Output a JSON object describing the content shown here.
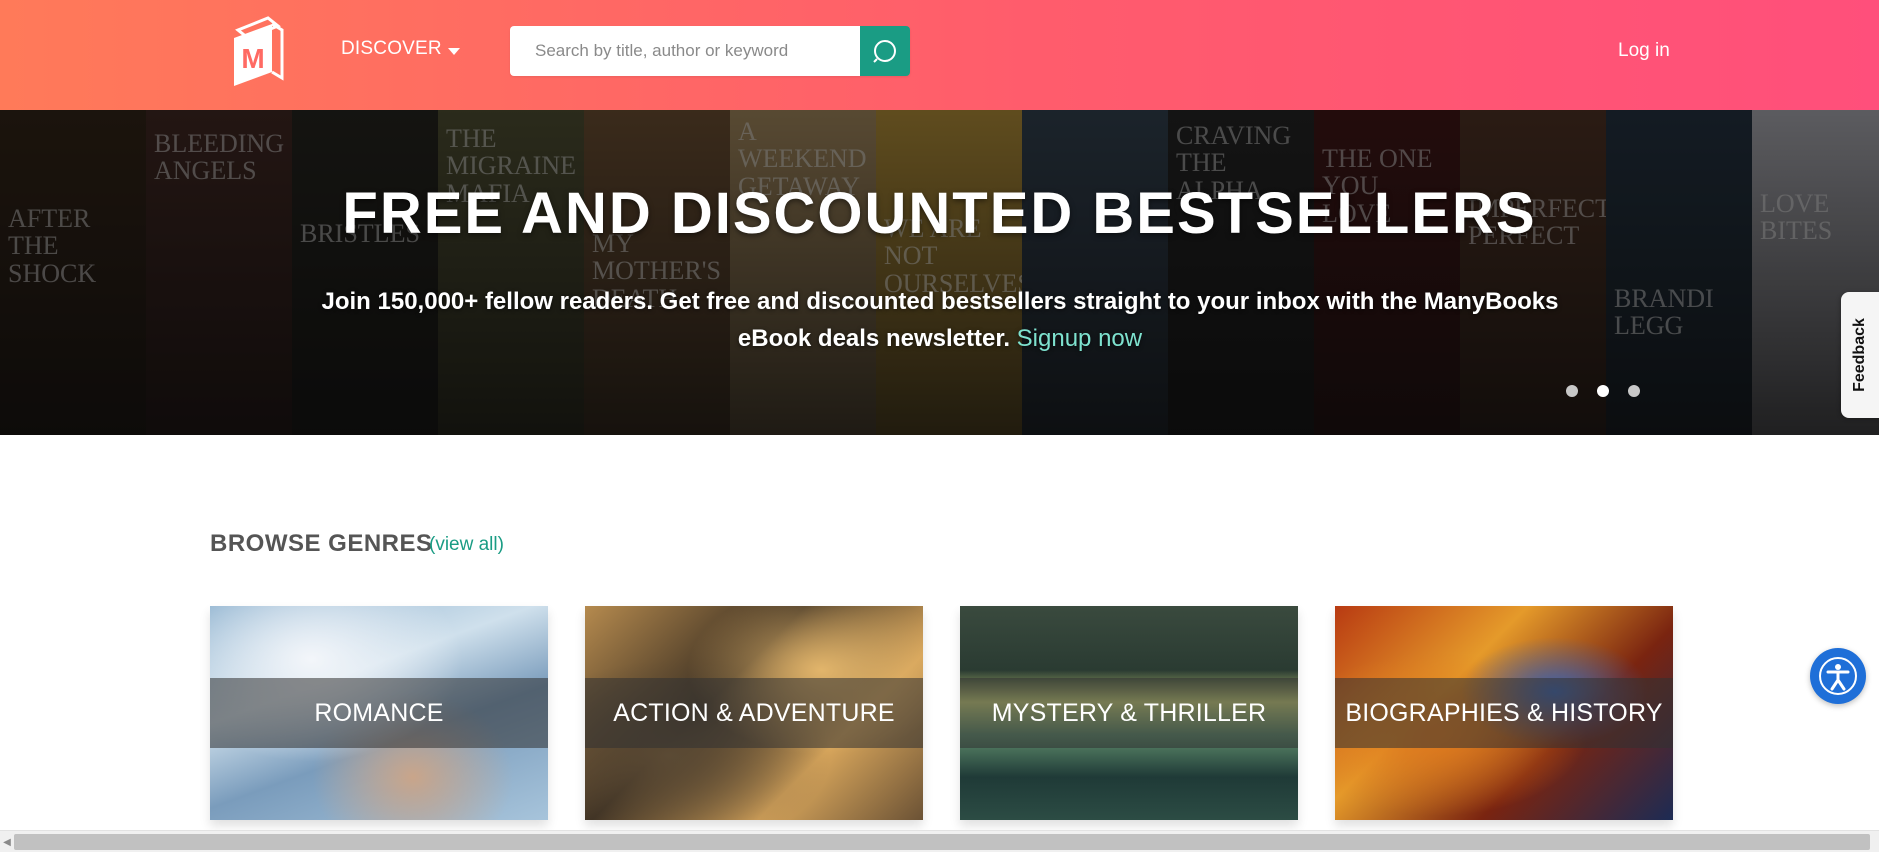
{
  "header": {
    "logo_letter": "M",
    "discover_label": "DISCOVER",
    "search_placeholder": "Search by title, author or keyword",
    "login_label": "Log in"
  },
  "hero": {
    "title": "FREE AND DISCOUNTED BESTSELLERS",
    "subtitle": "Join 150,000+ fellow readers. Get free and discounted bestsellers straight to your inbox with the ManyBooks eBook deals newsletter.",
    "signup_label": "Signup now",
    "book_covers": [
      {
        "title": "AFTER THE SHOCK",
        "color": "#3a2a1c"
      },
      {
        "title": "BLEEDING ANGELS",
        "color": "#4a2e28"
      },
      {
        "title": "BRISTLES",
        "color": "#2b2a24"
      },
      {
        "title": "THE MIGRAINE MAFIA",
        "color": "#5a5a3a"
      },
      {
        "title": "MY MOTHER'S DEATH",
        "color": "#7a5a3a"
      },
      {
        "title": "A Weekend Getaway",
        "color": "#b89a6a"
      },
      {
        "title": "We Are Not Ourselves",
        "color": "#c8a040"
      },
      {
        "title": "",
        "color": "#3a4a5a"
      },
      {
        "title": "CRAVING THE ALPHA",
        "color": "#2a2a2a"
      },
      {
        "title": "THE ONE YOU LOVE",
        "color": "#4a1a1a"
      },
      {
        "title": "Imperfectly Perfect",
        "color": "#5a3a2a"
      },
      {
        "title": "BRANDI LEGG",
        "color": "#2a3a4a"
      },
      {
        "title": "LOVE BITES",
        "color": "#c0c0c8"
      }
    ],
    "slide_count": 3,
    "active_slide": 2
  },
  "feedback_label": "Feedback",
  "genres": {
    "title": "BROWSE GENRES",
    "view_all_label": "(view all)",
    "items": [
      {
        "label": "ROMANCE"
      },
      {
        "label": "ACTION & ADVENTURE"
      },
      {
        "label": "MYSTERY & THRILLER"
      },
      {
        "label": "BIOGRAPHIES & HISTORY"
      }
    ]
  },
  "colors": {
    "header_gradient_start": "#ff7a59",
    "header_gradient_end": "#ff4f7b",
    "accent_teal": "#1a9c84",
    "signup_link": "#7ee2cf",
    "accessibility_blue": "#1f6fd8"
  },
  "icons": {
    "search": "search-icon",
    "accessibility": "accessibility-icon",
    "caret": "chevron-down-icon"
  }
}
